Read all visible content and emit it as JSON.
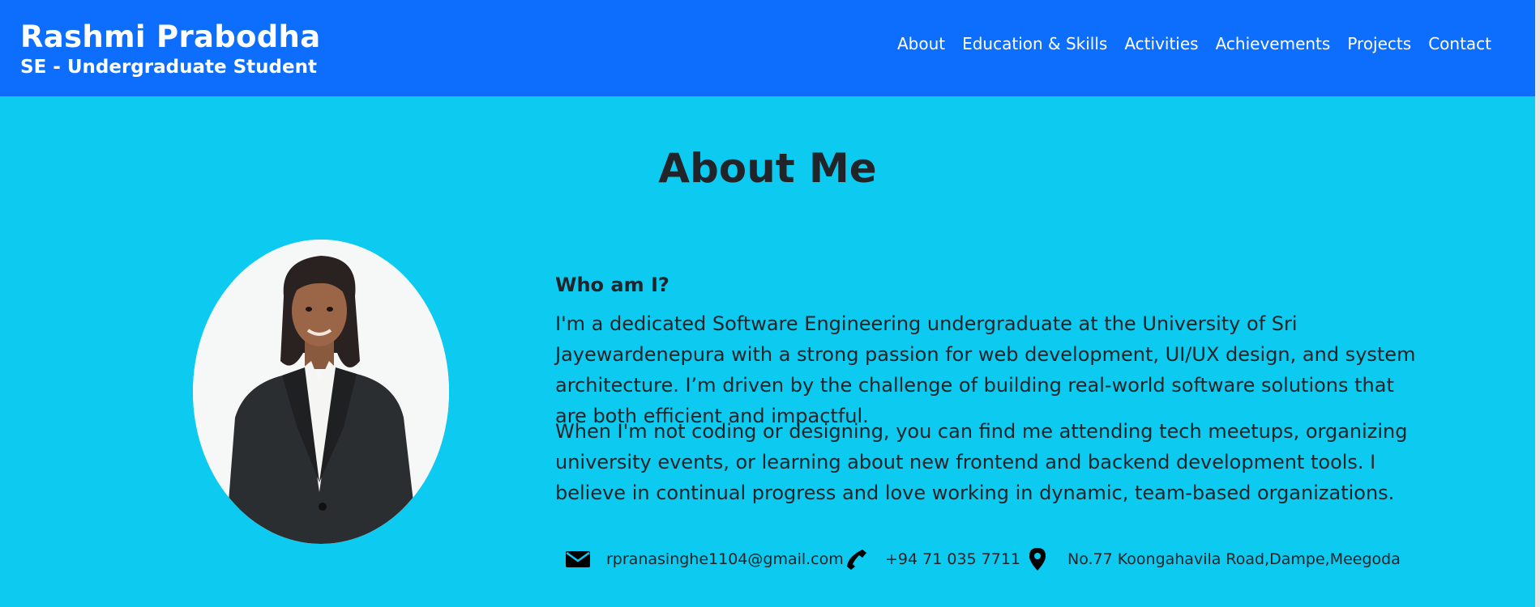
{
  "header": {
    "name": "Rashmi Prabodha",
    "subtitle": "SE - Undergraduate Student",
    "nav": [
      "About",
      "Education & Skills",
      "Activities",
      "Achievements",
      "Projects",
      "Contact"
    ]
  },
  "about": {
    "title": "About Me",
    "who_heading": "Who am I?",
    "paragraph1": "I'm a dedicated Software Engineering undergraduate at the University of Sri Jayewardenepura with a strong passion for web development, UI/UX design, and system architecture. I’m driven by the challenge of building real-world software solutions that are both efficient and impactful.",
    "paragraph2": "When I'm not coding or designing, you can find me attending tech meetups, organizing university events, or learning about new frontend and backend development tools. I believe in continual progress and love working in dynamic, team-based organizations.",
    "photo_icon": "profile-photo"
  },
  "contact": {
    "email": "rpranasinghe1104@gmail.com",
    "phone": "+94 71 035 7711",
    "address": "No.77 Koongahavila Road,Dampe,Meegoda",
    "icons": [
      "envelope-icon",
      "phone-icon",
      "map-pin-icon"
    ]
  },
  "colors": {
    "navbar_bg": "#0d6efd",
    "section_bg": "#0dcaf0",
    "text": "#212529"
  }
}
